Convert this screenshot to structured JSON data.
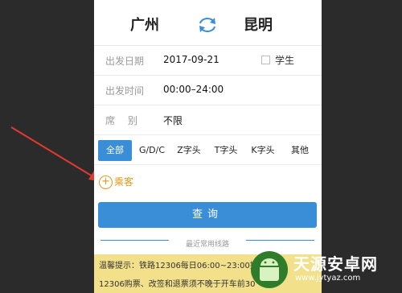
{
  "route": {
    "from": "广州",
    "to": "昆明",
    "swap_icon": "refresh-swap-icon"
  },
  "form": {
    "date_label": "出发日期",
    "date_value": "2017-09-21",
    "student_label": "学生",
    "time_label": "出发时间",
    "time_value": "00:00–24:00",
    "seat_label": "席别",
    "seat_value": "不限"
  },
  "filters": [
    "全部",
    "G/D/C",
    "Z字头",
    "T字头",
    "K字头",
    "其他"
  ],
  "passenger_label": "乘客",
  "query_label": "查询",
  "recent_routes_label": "最近常用线路",
  "notice": {
    "line1": "温馨提示：铁路12306每日06:00~23:00提",
    "line2": "12306购票、改签和退票须不晚于开车前30"
  },
  "watermark": {
    "title": "天源安卓网",
    "url": "www.jytyaz.com"
  },
  "colors": {
    "accent": "#3a8ed8",
    "passenger": "#e29a1e",
    "notice_bg": "#f3e08a",
    "arrow": "#e23a2f"
  }
}
